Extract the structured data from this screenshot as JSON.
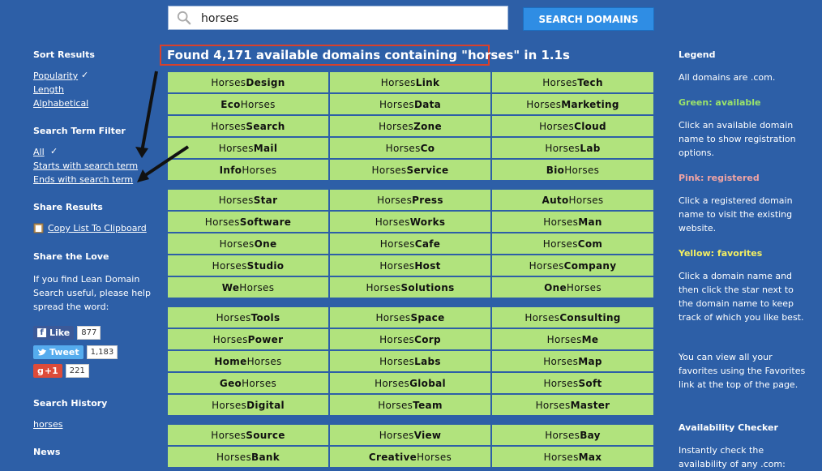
{
  "search": {
    "query": "horses",
    "button": "SEARCH DOMAINS"
  },
  "left": {
    "sort_heading": "Sort Results",
    "sort": [
      "Popularity",
      "Length",
      "Alphabetical"
    ],
    "filter_heading": "Search Term Filter",
    "filter": [
      "All",
      "Starts with search term",
      "Ends with search term"
    ],
    "check": "✓",
    "share_heading": "Share Results",
    "copy_link": "Copy List To Clipboard",
    "love_heading": "Share the Love",
    "love_text": "If you find Lean Domain Search useful, please help spread the word:",
    "social": [
      {
        "label": "Like",
        "count": "877",
        "color": "#3b5998"
      },
      {
        "label": "Tweet",
        "count": "1,183",
        "color": "#55acee"
      },
      {
        "label": "+1",
        "count": "221",
        "color": "#dd4b39"
      }
    ],
    "history_heading": "Search History",
    "history_item": "horses",
    "news_heading": "News"
  },
  "results": {
    "found": "Found 4,171 available domains containing \"horses\" in 1.1s",
    "groups": [
      [
        [
          [
            "Horses",
            "Design"
          ],
          [
            "Horses",
            "Link"
          ],
          [
            "Horses",
            "Tech"
          ]
        ],
        [
          [
            "Eco",
            "Horses"
          ],
          [
            "Horses",
            "Data"
          ],
          [
            "Horses",
            "Marketing"
          ]
        ],
        [
          [
            "Horses",
            "Search"
          ],
          [
            "Horses",
            "Zone"
          ],
          [
            "Horses",
            "Cloud"
          ]
        ],
        [
          [
            "Horses",
            "Mail"
          ],
          [
            "Horses",
            "Co"
          ],
          [
            "Horses",
            "Lab"
          ]
        ],
        [
          [
            "Info",
            "Horses"
          ],
          [
            "Horses",
            "Service"
          ],
          [
            "Bio",
            "Horses"
          ]
        ]
      ],
      [
        [
          [
            "Horses",
            "Star"
          ],
          [
            "Horses",
            "Press"
          ],
          [
            "Auto",
            "Horses"
          ]
        ],
        [
          [
            "Horses",
            "Software"
          ],
          [
            "Horses",
            "Works"
          ],
          [
            "Horses",
            "Man"
          ]
        ],
        [
          [
            "Horses",
            "One"
          ],
          [
            "Horses",
            "Cafe"
          ],
          [
            "Horses",
            "Com"
          ]
        ],
        [
          [
            "Horses",
            "Studio"
          ],
          [
            "Horses",
            "Host"
          ],
          [
            "Horses",
            "Company"
          ]
        ],
        [
          [
            "We",
            "Horses"
          ],
          [
            "Horses",
            "Solutions"
          ],
          [
            "One",
            "Horses"
          ]
        ]
      ],
      [
        [
          [
            "Horses",
            "Tools"
          ],
          [
            "Horses",
            "Space"
          ],
          [
            "Horses",
            "Consulting"
          ]
        ],
        [
          [
            "Horses",
            "Power"
          ],
          [
            "Horses",
            "Corp"
          ],
          [
            "Horses",
            "Me"
          ]
        ],
        [
          [
            "Home",
            "Horses"
          ],
          [
            "Horses",
            "Labs"
          ],
          [
            "Horses",
            "Map"
          ]
        ],
        [
          [
            "Geo",
            "Horses"
          ],
          [
            "Horses",
            "Global"
          ],
          [
            "Horses",
            "Soft"
          ]
        ],
        [
          [
            "Horses",
            "Digital"
          ],
          [
            "Horses",
            "Team"
          ],
          [
            "Horses",
            "Master"
          ]
        ]
      ],
      [
        [
          [
            "Horses",
            "Source"
          ],
          [
            "Horses",
            "View"
          ],
          [
            "Horses",
            "Bay"
          ]
        ],
        [
          [
            "Horses",
            "Bank"
          ],
          [
            "Creative",
            "Horses"
          ],
          [
            "Horses",
            "Max"
          ]
        ]
      ]
    ]
  },
  "right": {
    "legend_heading": "Legend",
    "all_com": "All domains are .com.",
    "green_label": "Green: available",
    "green_text": "Click an available domain name to show registration options.",
    "pink_label": "Pink: registered",
    "pink_text": "Click a registered domain name to visit the existing website.",
    "yellow_label": "Yellow: favorites",
    "yellow_text": "Click a domain name and then click the star next to the domain name to keep track of which you like best.",
    "fav_text": "You can view all your favorites using the Favorites link at the top of the page.",
    "checker_heading": "Availability Checker",
    "checker_text": "Instantly check the availability of any .com:"
  },
  "colors": {
    "background": "#2d5fa7",
    "available": "#b1e37d",
    "green_label": "#9be36a",
    "pink_label": "#f0a3a3",
    "yellow_label": "#f3ee62",
    "highlight": "#d9402b"
  }
}
